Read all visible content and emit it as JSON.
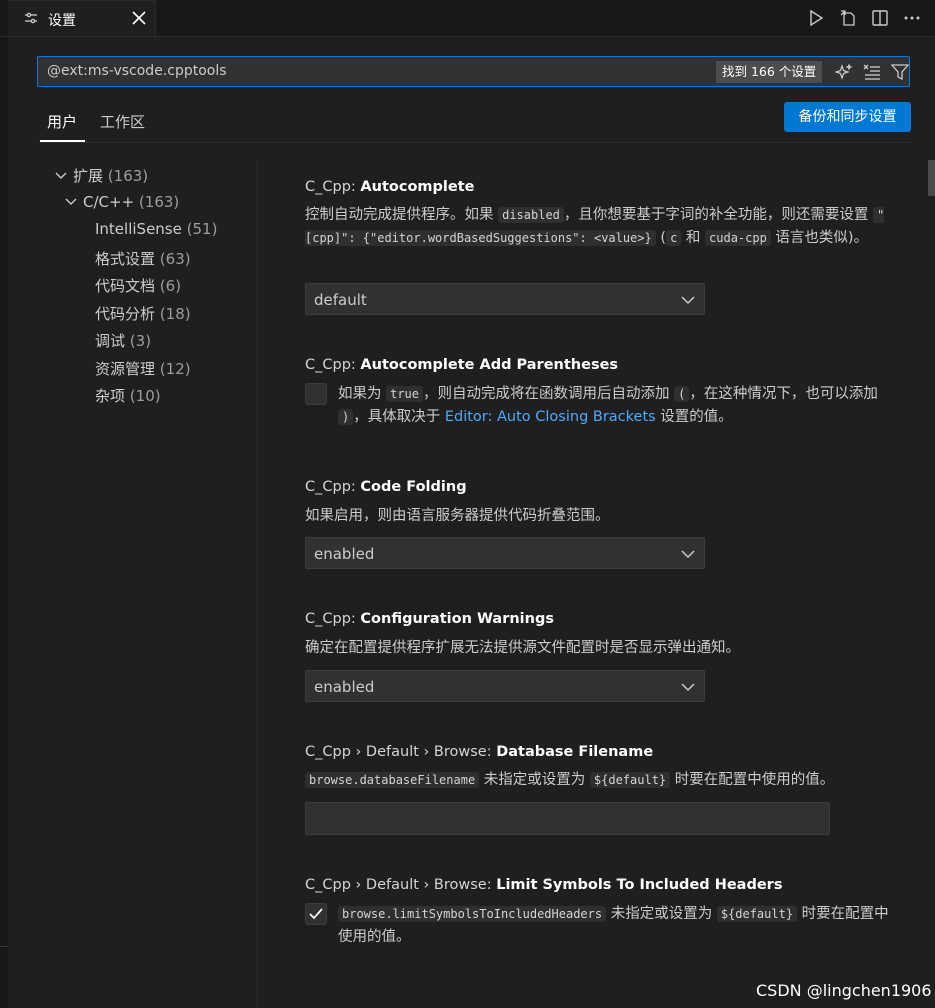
{
  "tab": {
    "title": "设置"
  },
  "search": {
    "value": "@ext:ms-vscode.cpptools",
    "found": "找到 166 个设置"
  },
  "scopes": {
    "user": "用户",
    "workspace": "工作区"
  },
  "sync_button": "备份和同步设置",
  "tree": [
    {
      "label": "扩展",
      "count": "(163)"
    },
    {
      "label": "C/C++",
      "count": "(163)"
    },
    {
      "label": "IntelliSense",
      "count": "(51)"
    },
    {
      "label": "格式设置",
      "count": "(63)"
    },
    {
      "label": "代码文档",
      "count": "(6)"
    },
    {
      "label": "代码分析",
      "count": "(18)"
    },
    {
      "label": "调试",
      "count": "(3)"
    },
    {
      "label": "资源管理",
      "count": "(12)"
    },
    {
      "label": "杂项",
      "count": "(10)"
    }
  ],
  "settings": {
    "autocomplete": {
      "prefix": "C_Cpp: ",
      "name": "Autocomplete",
      "d1": "控制自动完成提供程序。如果 ",
      "c1": "disabled",
      "d2": "，且你想要基于字词的补全功能，则还需要设置 ",
      "c2": "\"[cpp]\": {\"editor.wordBasedSuggestions\": <value>}",
      "d3": " (",
      "c3": "c",
      "d4": " 和 ",
      "c4": "cuda-cpp",
      "d5": " 语言也类似)。",
      "value": "default"
    },
    "autocomplete_parens": {
      "prefix": "C_Cpp: ",
      "name": "Autocomplete Add Parentheses",
      "d1": "如果为 ",
      "c1": "true",
      "d2": "，则自动完成将在函数调用后自动添加 ",
      "c2": "(",
      "d3": "，在这种情况下，也可以添加 ",
      "c3": ")",
      "d4": "，具体取决于 ",
      "link": "Editor: Auto Closing Brackets",
      "d5": " 设置的值。"
    },
    "code_folding": {
      "prefix": "C_Cpp: ",
      "name": "Code Folding",
      "desc": "如果启用，则由语言服务器提供代码折叠范围。",
      "value": "enabled"
    },
    "config_warnings": {
      "prefix": "C_Cpp: ",
      "name": "Configuration Warnings",
      "desc": "确定在配置提供程序扩展无法提供源文件配置时是否显示弹出通知。",
      "value": "enabled"
    },
    "db_filename": {
      "prefix": "C_Cpp › Default › Browse: ",
      "name": "Database Filename",
      "c1": "browse.databaseFilename",
      "d1": " 未指定或设置为 ",
      "c2": "${default}",
      "d2": " 时要在配置中使用的值。"
    },
    "limit_symbols": {
      "prefix": "C_Cpp › Default › Browse: ",
      "name": "Limit Symbols To Included Headers",
      "c1": "browse.limitSymbolsToIncludedHeaders",
      "d1": " 未指定或设置为 ",
      "c2": "${default}",
      "d2": " 时要在配置中使用的值。",
      "checked": true
    }
  },
  "watermark": "CSDN @lingchen1906",
  "colors": {
    "accent": "#0078d4",
    "link": "#4daafc",
    "background": "#1f1f1f"
  }
}
